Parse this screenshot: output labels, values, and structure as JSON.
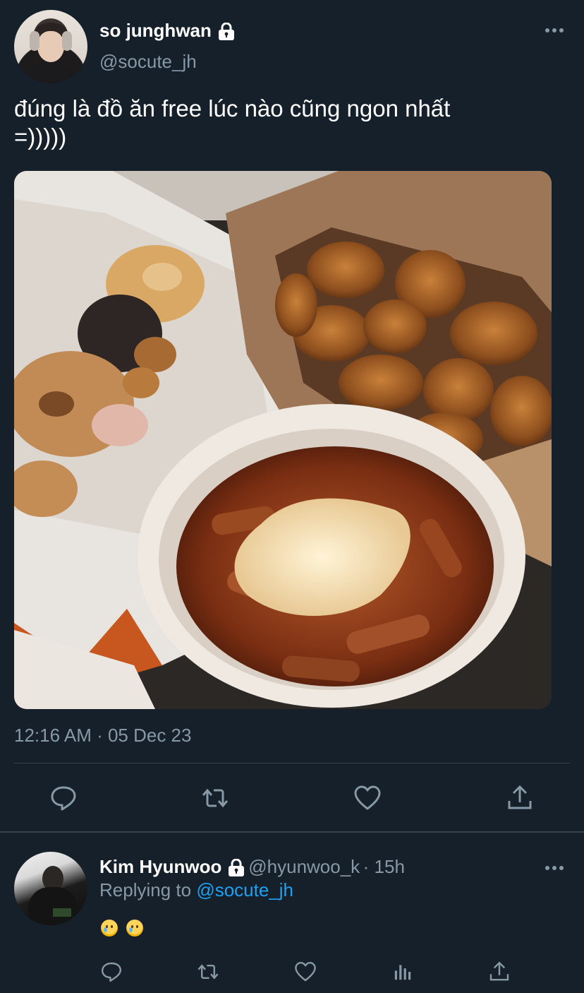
{
  "tweet": {
    "author_name": "so junghwan",
    "author_handle": "@socute_jh",
    "text_line1": "đúng là đồ ăn free lúc nào cũng ngon nhất",
    "text_line2": "=)))))",
    "timestamp": "12:16 AM · 05 Dec 23",
    "more_icon": "more-dots-icon",
    "photo_alt": "food-photo"
  },
  "actions": {
    "main": [
      "reply-icon",
      "retweet-icon",
      "like-icon",
      "share-icon"
    ],
    "reply": [
      "reply-icon",
      "retweet-icon",
      "like-icon",
      "analytics-icon",
      "share-icon"
    ]
  },
  "reply": {
    "author_name": "Kim Hyunwoo",
    "author_handle": "@hyunwoo_k",
    "time": "· 15h",
    "replying_label": "Replying to",
    "replying_handle": "@socute_jh",
    "emojis": [
      "crying-face",
      "crying-face"
    ]
  },
  "colors": {
    "background": "#15202b",
    "text": "#ffffff",
    "secondary": "#8899a6",
    "accent": "#1da1f2",
    "divider": "#38444d"
  }
}
